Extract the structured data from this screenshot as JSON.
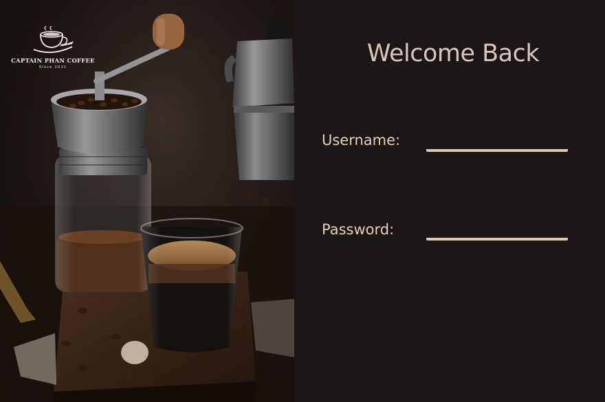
{
  "brand": {
    "name": "CAPTAIN PHAN COFFEE",
    "since": "Since 2021",
    "logo_icon": "coffee-cup-icon"
  },
  "login": {
    "title": "Welcome Back",
    "username_label": "Username:",
    "username_value": "",
    "password_label": "Password:",
    "password_value": ""
  },
  "colors": {
    "panel_background": "#1d1617",
    "title_text": "#d8c6bd",
    "label_text": "#e5cfbd",
    "input_underline": "#e2c8aa"
  }
}
